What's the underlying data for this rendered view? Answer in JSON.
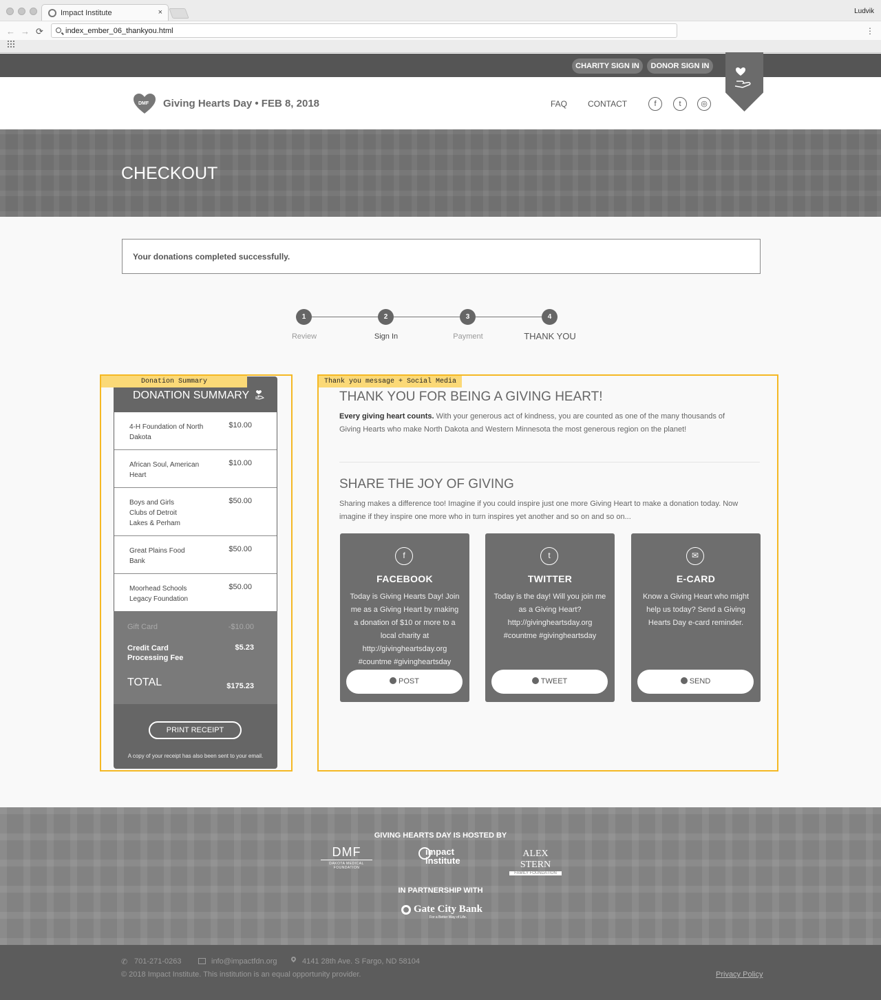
{
  "browser": {
    "tab_title": "Impact Institute",
    "tab_close": "×",
    "user": "Ludvik",
    "url": "index_ember_06_thankyou.html",
    "back": "←",
    "forward": "→",
    "reload": "⟳",
    "menu": "⋮"
  },
  "topbar": {
    "charity_signin": "CHARITY SIGN IN",
    "donor_signin": "DONOR SIGN IN"
  },
  "header": {
    "logo_mark": "DMF",
    "brand": "Giving Hearts Day • FEB 8, 2018",
    "nav": [
      "FAQ",
      "CONTACT"
    ],
    "social": {
      "facebook": "f",
      "twitter": "t",
      "instagram": "◎"
    }
  },
  "hero": {
    "title": "CHECKOUT"
  },
  "alert": "Your donations completed successfully.",
  "steps": [
    {
      "num": "1",
      "label": "Review"
    },
    {
      "num": "2",
      "label": "Sign In"
    },
    {
      "num": "3",
      "label": "Payment"
    },
    {
      "num": "4",
      "label": "THANK YOU"
    }
  ],
  "annotations": {
    "summary": "Donation Summary",
    "thankyou": "Thank you message + Social Media"
  },
  "summary": {
    "title": "DONATION SUMMARY",
    "items": [
      {
        "name": "4-H Foundation of North Dakota",
        "amount": "$10.00"
      },
      {
        "name": "African Soul, American Heart",
        "amount": "$10.00"
      },
      {
        "name": "Boys and Girls Clubs of Detroit Lakes & Perham",
        "amount": "$50.00"
      },
      {
        "name": "Great Plains Food Bank",
        "amount": "$50.00"
      },
      {
        "name": "Moorhead Schools Legacy Foundation",
        "amount": "$50.00"
      }
    ],
    "gift_card_label": "Gift Card",
    "gift_card_amount": "-$10.00",
    "fee_label": "Credit Card Processing Fee",
    "fee_amount": "$5.23",
    "total_label": "TOTAL",
    "total_amount": "$175.23",
    "print_button": "PRINT RECEIPT",
    "receipt_note": "A copy of your receipt has also been sent to your email."
  },
  "thankyou": {
    "title": "THANK YOU FOR BEING A GIVING HEART!",
    "lead_bold": "Every giving heart counts.",
    "lead_text": " With your generous act of kindness, you are counted as one of the many thousands of Giving Hearts who make North Dakota and Western Minnesota the most generous region on the planet!",
    "share_title": "SHARE THE JOY OF GIVING",
    "share_text": "Sharing makes a difference too! Imagine if you could inspire just one more Giving Heart to make a donation today. Now imagine if they inspire one more who in turn inspires yet another and so on and so on..."
  },
  "share_cards": [
    {
      "icon": "f",
      "title": "FACEBOOK",
      "text": "Today is Giving Hearts Day! Join me as a Giving Heart by making a donation of $10 or more to a local charity at http://givingheartsday.org #countme #givingheartsday",
      "button": "POST"
    },
    {
      "icon": "t",
      "title": "TWITTER",
      "text": "Today is the day! Will you join me as a Giving Heart? http://givingheartsday.org #countme #givingheartsday",
      "button": "TWEET"
    },
    {
      "icon": "✉",
      "title": "E-CARD",
      "text": "Know a Giving Heart who might help us today? Send a Giving Hearts Day e-card reminder.",
      "button": "SEND"
    }
  ],
  "footer": {
    "hosted_by": "GIVING HEARTS DAY IS HOSTED BY",
    "dmf_logo": "DMF",
    "dmf_sub": "DAKOTA MEDICAL FOUNDATION",
    "impact_logo": "impact institute",
    "stern_logo": "ALEX STERN",
    "stern_sub": "FAMILY FOUNDATION",
    "partnership": "IN PARTNERSHIP WITH",
    "bank_logo": "Gate City Bank",
    "bank_tag": "For a Better Way of Life."
  },
  "contact": {
    "phone": "701-271-0263",
    "email": "info@impactfdn.org",
    "address": "4141 28th Ave. S Fargo, ND 58104",
    "copyright": "© 2018 Impact Institute. This institution is an equal opportunity provider.",
    "privacy": "Privacy Policy"
  }
}
